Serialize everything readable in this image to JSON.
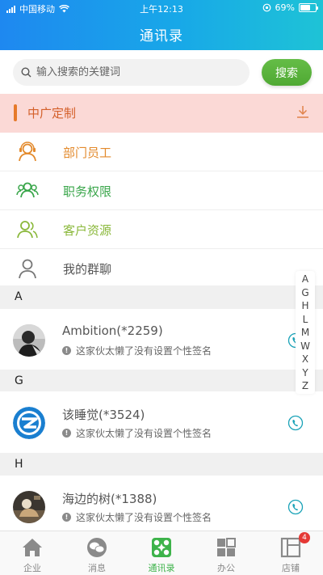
{
  "status_bar": {
    "carrier": "中国移动",
    "time": "上午12:13",
    "battery": "69%",
    "battery_level": 0.69
  },
  "header": {
    "title": "通讯录"
  },
  "search": {
    "placeholder": "输入搜索的关键词",
    "value": "",
    "button_label": "搜索"
  },
  "company": {
    "name": "中广定制",
    "accent_color": "#e67a2a",
    "icon": "download-icon"
  },
  "menu": [
    {
      "label": "部门员工",
      "icon": "department-staff-icon",
      "color": "#e38a2c"
    },
    {
      "label": "职务权限",
      "icon": "position-permission-icon",
      "color": "#3aa64b"
    },
    {
      "label": "客户资源",
      "icon": "customer-resource-icon",
      "color": "#8ab83a"
    },
    {
      "label": "我的群聊",
      "icon": "group-chat-icon",
      "color": "#555555"
    }
  ],
  "sections": [
    {
      "letter": "A",
      "contacts": [
        {
          "name": "Ambition(*2259)",
          "signature": "这家伙太懒了没有设置个性签名"
        }
      ]
    },
    {
      "letter": "G",
      "contacts": [
        {
          "name": "该睡觉(*3524)",
          "signature": "这家伙太懒了没有设置个性签名"
        }
      ]
    },
    {
      "letter": "H",
      "contacts": [
        {
          "name": "海边的树(*1388)",
          "signature": "这家伙太懒了没有设置个性签名"
        }
      ]
    }
  ],
  "index_letters": [
    "A",
    "G",
    "H",
    "L",
    "M",
    "W",
    "X",
    "Y",
    "Z"
  ],
  "tabs": [
    {
      "label": "企业",
      "icon": "home-icon",
      "active": false
    },
    {
      "label": "消息",
      "icon": "chat-bubble-icon",
      "active": false
    },
    {
      "label": "通讯录",
      "icon": "contacts-icon",
      "active": true
    },
    {
      "label": "办公",
      "icon": "office-grid-icon",
      "active": false
    },
    {
      "label": "店铺",
      "icon": "store-icon",
      "active": false,
      "badge": "4"
    }
  ],
  "colors": {
    "header_start": "#1e88f0",
    "header_end": "#1ec3d6",
    "search_button": "#56b23b",
    "active_tab": "#3db34a",
    "phone_icon": "#1ba3b8"
  }
}
